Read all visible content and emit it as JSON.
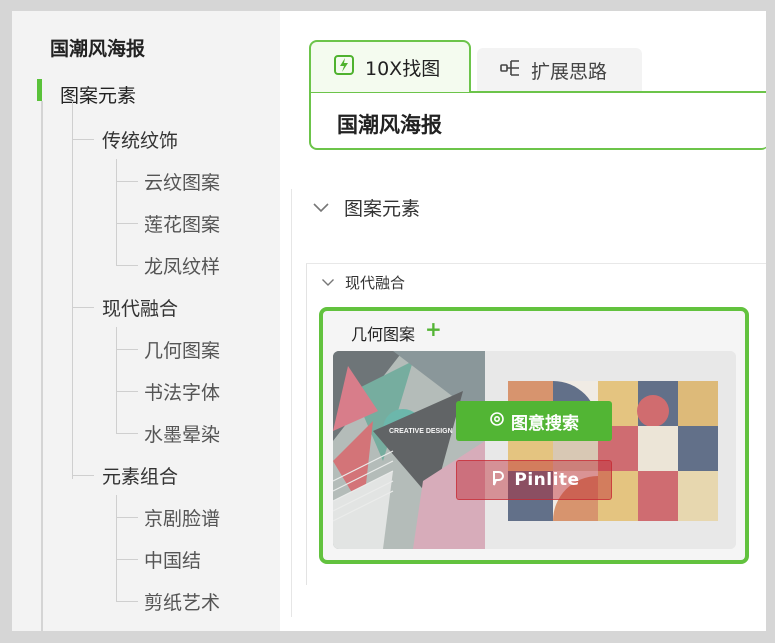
{
  "sidebar": {
    "title": "国潮风海报",
    "section": "图案元素",
    "groups": [
      {
        "label": "传统纹饰",
        "items": [
          "云纹图案",
          "莲花图案",
          "龙凤纹样"
        ]
      },
      {
        "label": "现代融合",
        "items": [
          "几何图案",
          "书法字体",
          "水墨晕染"
        ]
      },
      {
        "label": "元素组合",
        "items": [
          "京剧脸谱",
          "中国结",
          "剪纸艺术"
        ]
      }
    ]
  },
  "tabs": [
    {
      "label": "10X找图",
      "icon": "lightning-icon",
      "active": true
    },
    {
      "label": "扩展思路",
      "icon": "mindmap-icon",
      "active": false
    }
  ],
  "search": {
    "query": "国潮风海报"
  },
  "main": {
    "section_title": "图案元素",
    "subsection_title": "现代融合",
    "card": {
      "title": "几何图案",
      "preview_text": "CREATIVE DESIGN",
      "buttons": {
        "image_search": "图意搜索",
        "pinlite": "Pinlite"
      }
    }
  },
  "colors": {
    "accent": "#62c23e",
    "pinlite": "#c0283a"
  }
}
